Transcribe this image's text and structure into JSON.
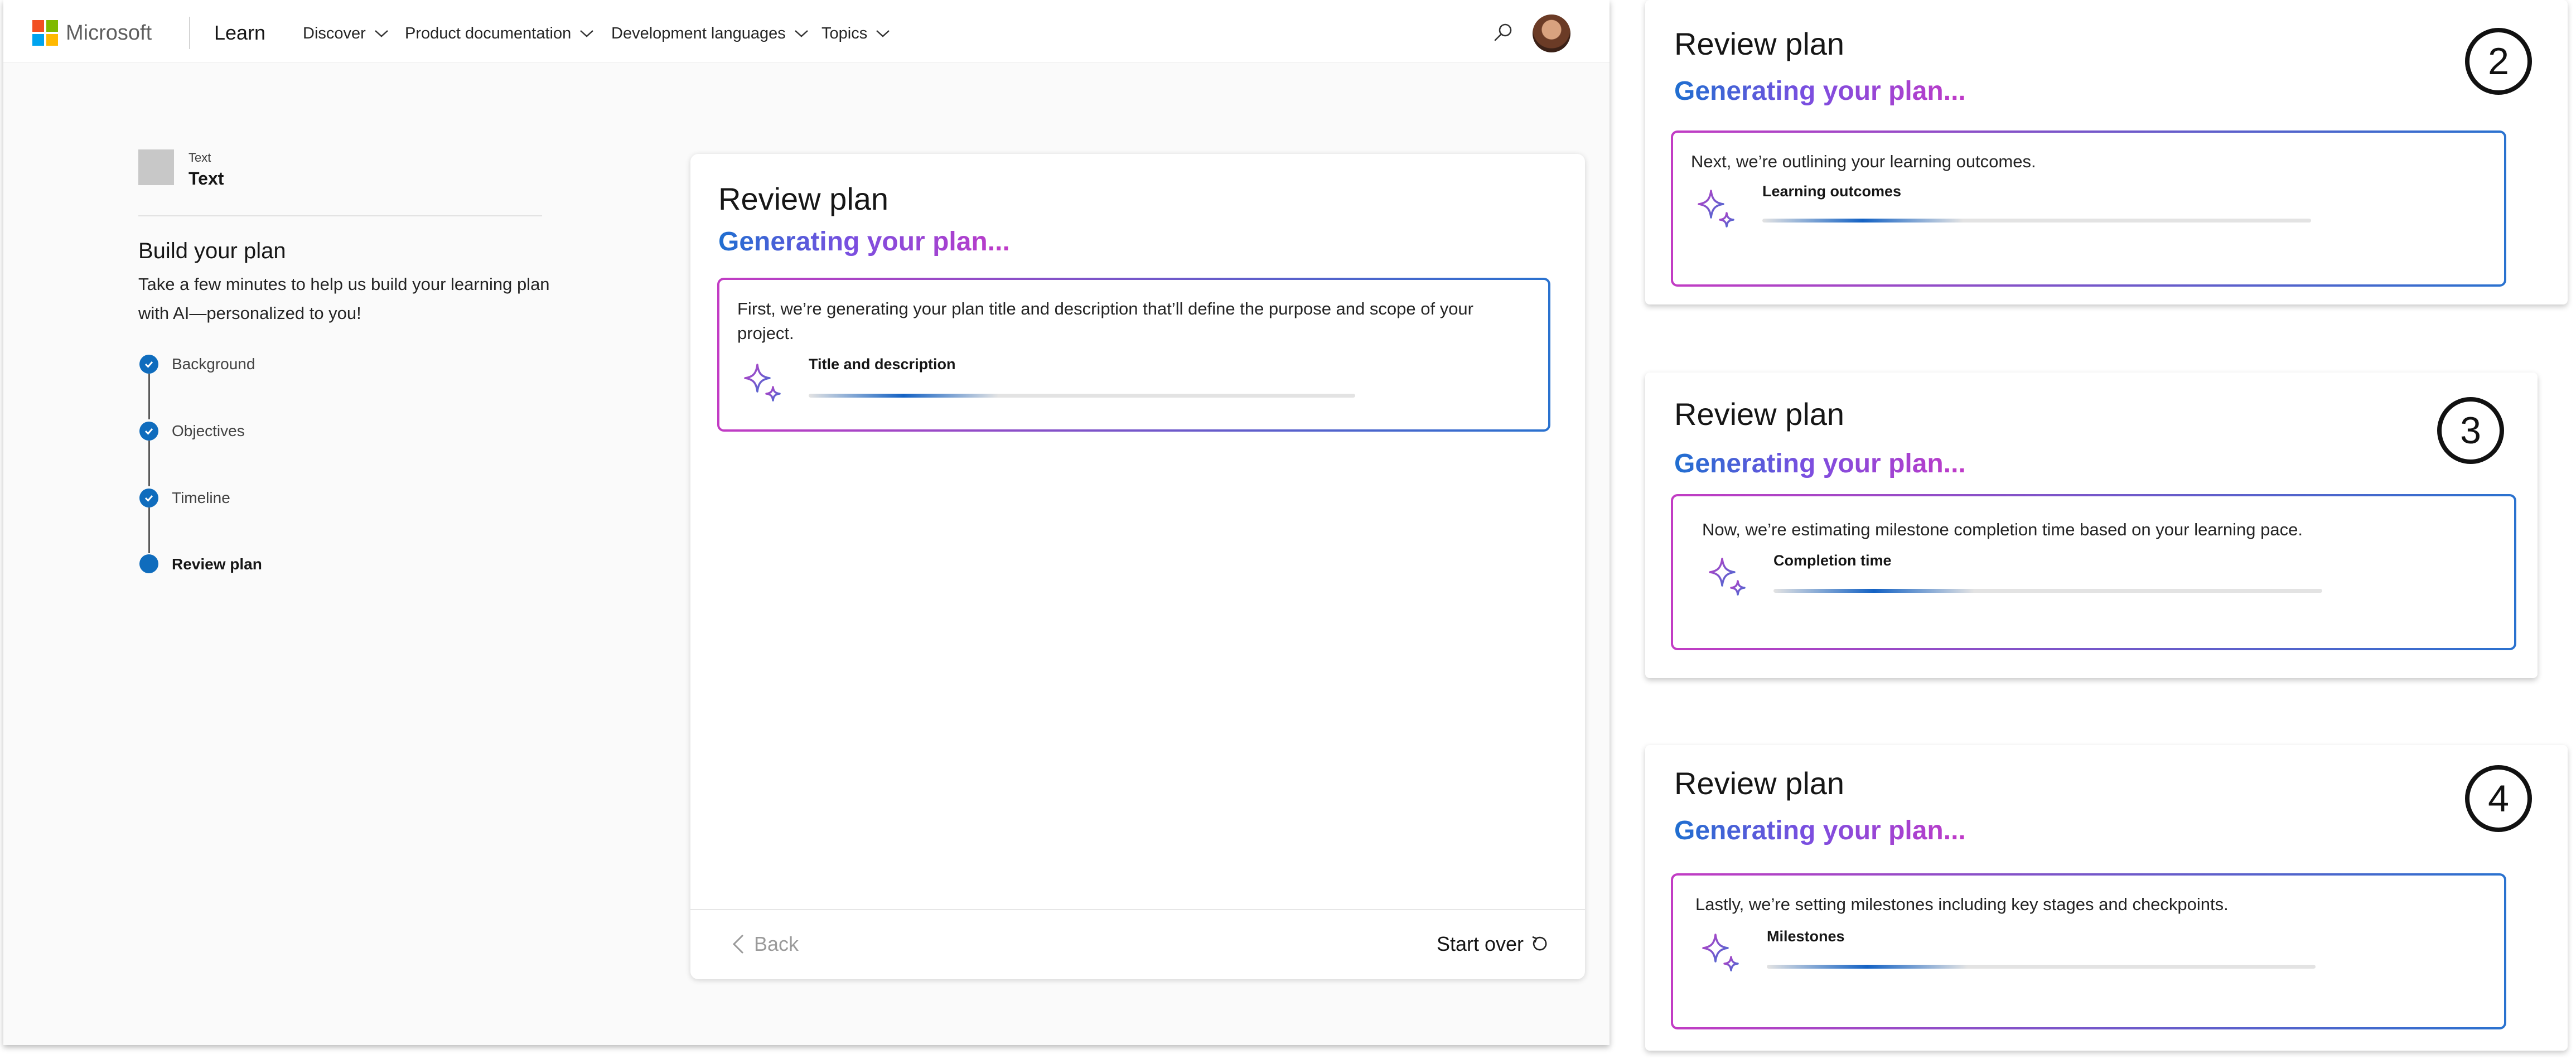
{
  "nav": {
    "brand": "Microsoft",
    "learn": "Learn",
    "items": [
      "Discover",
      "Product documentation",
      "Development languages",
      "Topics"
    ]
  },
  "colors": {
    "ms_red": "#f25022",
    "ms_green": "#7fba00",
    "ms_blue": "#00a4ef",
    "ms_yellow": "#ffb900",
    "accent_blue": "#0f6cbd",
    "gradient_pink": "#c23cc4",
    "gradient_blue": "#2a72cf"
  },
  "sidebar": {
    "text_small": "Text",
    "text_big": "Text",
    "title": "Build your plan",
    "description": "Take a few minutes to help us build your learning plan with AI—personalized to you!",
    "steps": [
      {
        "label": "Background",
        "state": "complete"
      },
      {
        "label": "Objectives",
        "state": "complete"
      },
      {
        "label": "Timeline",
        "state": "complete"
      },
      {
        "label": "Review plan",
        "state": "current"
      }
    ]
  },
  "main_card": {
    "title": "Review plan",
    "generating": "Generating your plan...",
    "description": "First, we’re generating your plan title and description that’ll define the purpose and scope of your project.",
    "sublabel": "Title and description",
    "back_label": "Back",
    "start_over_label": "Start over"
  },
  "panels": [
    {
      "number": "2",
      "title": "Review plan",
      "generating": "Generating your plan...",
      "description": "Next, we’re outlining your learning outcomes.",
      "sublabel": "Learning outcomes"
    },
    {
      "number": "3",
      "title": "Review plan",
      "generating": "Generating your plan...",
      "description": "Now, we’re estimating milestone completion time based on your learning pace.",
      "sublabel": "Completion time"
    },
    {
      "number": "4",
      "title": "Review plan",
      "generating": "Generating your plan...",
      "description": "Lastly, we’re setting milestones including key stages and checkpoints.",
      "sublabel": "Milestones"
    }
  ]
}
